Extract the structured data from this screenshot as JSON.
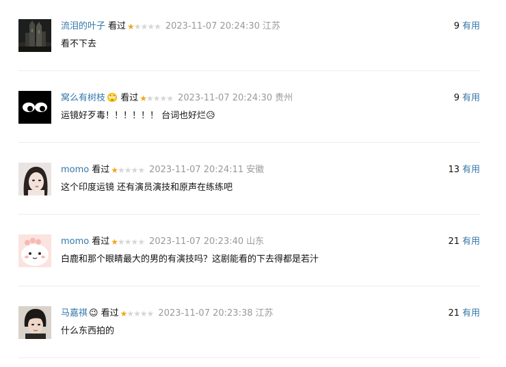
{
  "comments": [
    {
      "user": "流泪的叶子",
      "user_emoji": "",
      "watched": "看过",
      "rating": 1,
      "time": "2023-11-07 20:24:30",
      "location": "江苏",
      "votes": "9",
      "vote_label": "有用",
      "text": "看不下去",
      "avatar": "church-night-avatar"
    },
    {
      "user": "窝么有树枝",
      "user_emoji": "🙄",
      "watched": "看过",
      "rating": 1,
      "time": "2023-11-07 20:24:30",
      "location": "贵州",
      "votes": "9",
      "vote_label": "有用",
      "text": "运镜好歹毒！！！！！！ 台词也好烂😥",
      "avatar": "cartoon-eyes-avatar"
    },
    {
      "user": "momo",
      "user_emoji": "",
      "watched": "看过",
      "rating": 1,
      "time": "2023-11-07 20:24:11",
      "location": "安徽",
      "votes": "13",
      "vote_label": "有用",
      "text": "这个印度运镜 还有演员演技和原声在练练吧",
      "avatar": "girl-portrait-avatar"
    },
    {
      "user": "momo",
      "user_emoji": "",
      "watched": "看过",
      "rating": 1,
      "time": "2023-11-07 20:23:40",
      "location": "山东",
      "votes": "21",
      "vote_label": "有用",
      "text": "白鹿和那个眼睛最大的男的有演技吗？这剧能看的下去得都是若汁",
      "avatar": "pink-cartoon-avatar"
    },
    {
      "user": "马嘉祺",
      "user_emoji": "😉",
      "watched": "看过",
      "rating": 1,
      "time": "2023-11-07 20:23:38",
      "location": "江苏",
      "votes": "21",
      "vote_label": "有用",
      "text": "什么东西拍的",
      "avatar": "boy-portrait-avatar"
    }
  ],
  "colors": {
    "link": "#3377aa",
    "star_on": "#f2a51c",
    "star_off": "#d6d6d6",
    "meta_gray": "#999999",
    "divider": "#ececec"
  }
}
